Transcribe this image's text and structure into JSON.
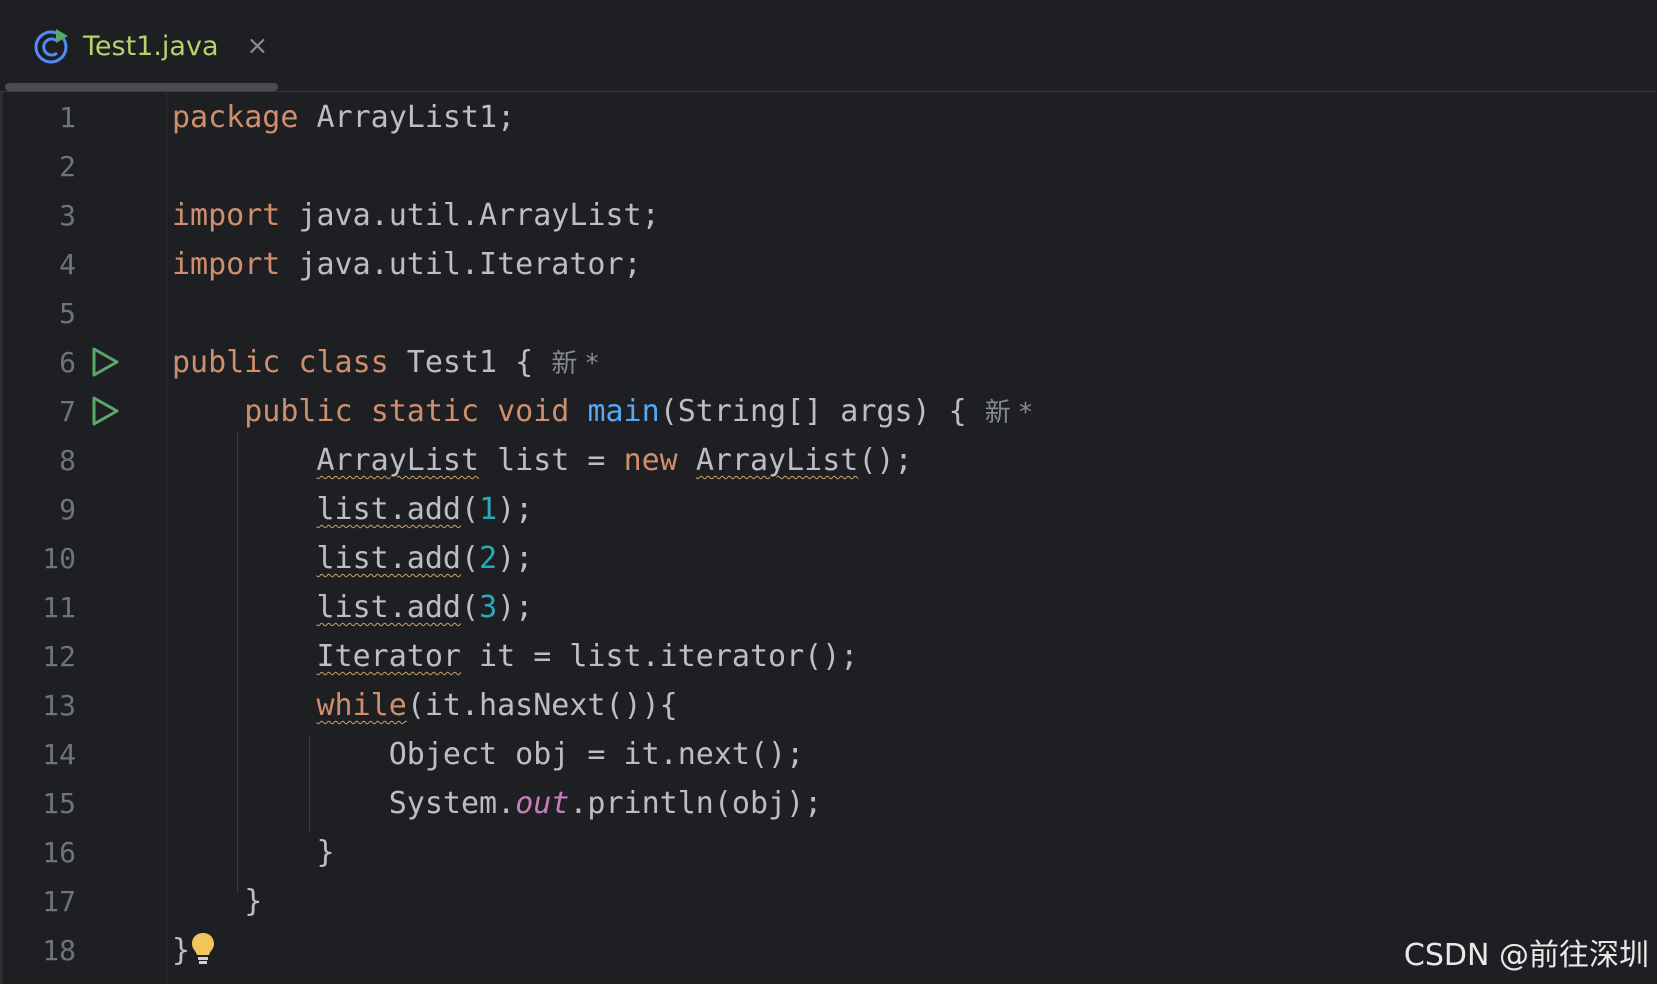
{
  "tab": {
    "label": "Test1.java",
    "close_glyph": "×"
  },
  "hints": {
    "class_hint": "新 *",
    "method_hint": "新 *"
  },
  "line_numbers": [
    "1",
    "2",
    "3",
    "4",
    "5",
    "6",
    "7",
    "8",
    "9",
    "10",
    "11",
    "12",
    "13",
    "14",
    "15",
    "16",
    "17",
    "18"
  ],
  "code": {
    "l1_kw": "package",
    "l1_rest": " ArrayList1;",
    "l3_kw": "import",
    "l3_rest": " java.util.ArrayList;",
    "l4_kw": "import",
    "l4_rest": " java.util.Iterator;",
    "l6_kw1": "public",
    "l6_kw2": "class",
    "l6_rest": " Test1 { ",
    "l7_kw1": "public",
    "l7_kw2": "static",
    "l7_kw3": "void",
    "l7_fn": "main",
    "l7_rest": "(String[] args) { ",
    "l8_type": "ArrayList",
    "l8_mid": " list = ",
    "l8_kw": "new",
    "l8_type2": "ArrayList",
    "l8_end": "();",
    "l9_call": "list.add",
    "l9_open": "(",
    "l9_num": "1",
    "l9_end": ");",
    "l10_call": "list.add",
    "l10_open": "(",
    "l10_num": "2",
    "l10_end": ");",
    "l11_call": "list.add",
    "l11_open": "(",
    "l11_num": "3",
    "l11_end": ");",
    "l12_type": "Iterator",
    "l12_rest": " it = list.iterator();",
    "l13_kw": "while",
    "l13_rest": "(it.hasNext()){",
    "l14": "Object obj = it.next();",
    "l15_a": "System.",
    "l15_field": "out",
    "l15_b": ".println(obj);",
    "l16": "}",
    "l17": "}",
    "l18": "}"
  },
  "watermark": "CSDN @前往深圳",
  "colors": {
    "background": "#1e1f22",
    "keyword": "#cf8e6d",
    "function": "#56a8f5",
    "number": "#2aacb8",
    "field": "#c77dbb",
    "tab_label": "#b6d36b",
    "run_icon": "#59a869",
    "bulb": "#f2c55c"
  },
  "icons": {
    "tab_icon": "java-class-icon",
    "run": "run-play-icon",
    "intention": "lightbulb-icon"
  }
}
